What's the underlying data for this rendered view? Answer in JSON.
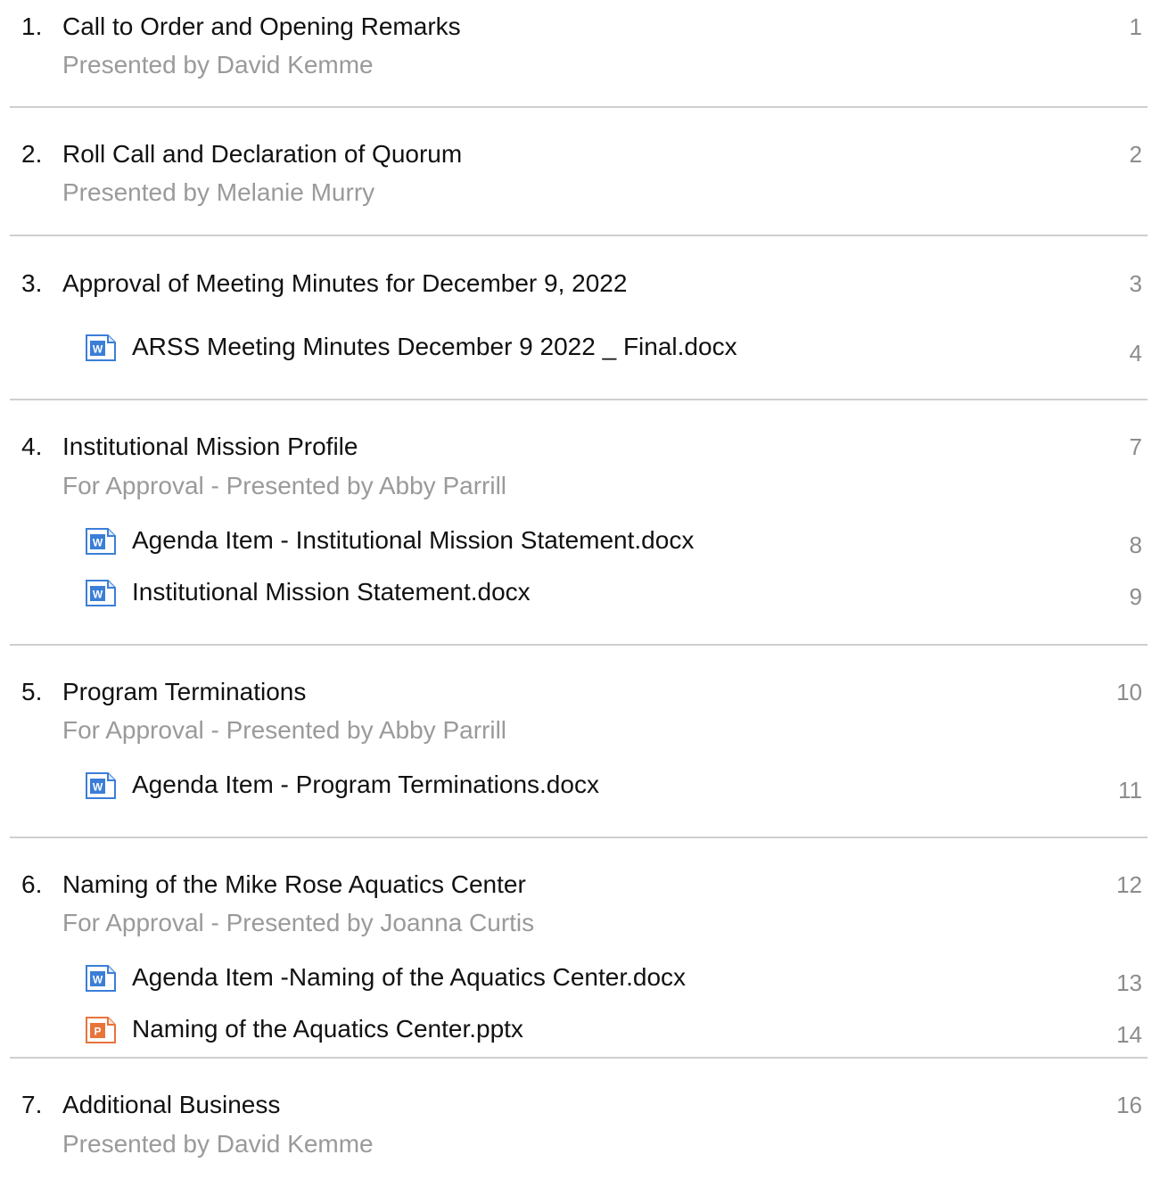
{
  "agenda": {
    "items": [
      {
        "number": "1.",
        "title": "Call to Order and Opening Remarks",
        "presenter": "Presented by David Kemme",
        "page": "1",
        "attachments": []
      },
      {
        "number": "2.",
        "title": "Roll Call and Declaration of Quorum",
        "presenter": "Presented by Melanie Murry",
        "page": "2",
        "attachments": []
      },
      {
        "number": "3.",
        "title": "Approval of Meeting Minutes for December 9, 2022",
        "presenter": "",
        "page": "3",
        "attachments": [
          {
            "name": "ARSS Meeting Minutes December 9 2022 _ Final.docx",
            "page": "4",
            "icon": "word-doc-icon"
          }
        ]
      },
      {
        "number": "4.",
        "title": "Institutional Mission Profile",
        "presenter": "For Approval - Presented by Abby Parrill",
        "page": "7",
        "attachments": [
          {
            "name": "Agenda Item - Institutional Mission Statement.docx",
            "page": "8",
            "icon": "word-doc-icon"
          },
          {
            "name": "Institutional Mission Statement.docx",
            "page": "9",
            "icon": "word-doc-icon"
          }
        ]
      },
      {
        "number": "5.",
        "title": "Program Terminations",
        "presenter": "For Approval - Presented by Abby Parrill",
        "page": "10",
        "attachments": [
          {
            "name": "Agenda Item - Program Terminations.docx",
            "page": "11",
            "icon": "word-doc-icon"
          }
        ]
      },
      {
        "number": "6.",
        "title": "Naming of the Mike Rose Aquatics Center",
        "presenter": "For Approval - Presented by Joanna Curtis",
        "page": "12",
        "attachments": [
          {
            "name": "Agenda Item -Naming of the Aquatics Center.docx",
            "page": "13",
            "icon": "word-doc-icon"
          },
          {
            "name": "Naming of the Aquatics Center.pptx",
            "page": "14",
            "icon": "powerpoint-doc-icon"
          }
        ]
      },
      {
        "number": "7.",
        "title": "Additional Business",
        "presenter": "Presented by David Kemme",
        "page": "16",
        "attachments": []
      }
    ]
  },
  "colors": {
    "text": "#111111",
    "presenter": "#9a9a9a",
    "page_number": "#8c8c8c",
    "divider": "#cfcfcf",
    "word_icon": "#3b7ed8",
    "powerpoint_icon": "#e8743b"
  }
}
